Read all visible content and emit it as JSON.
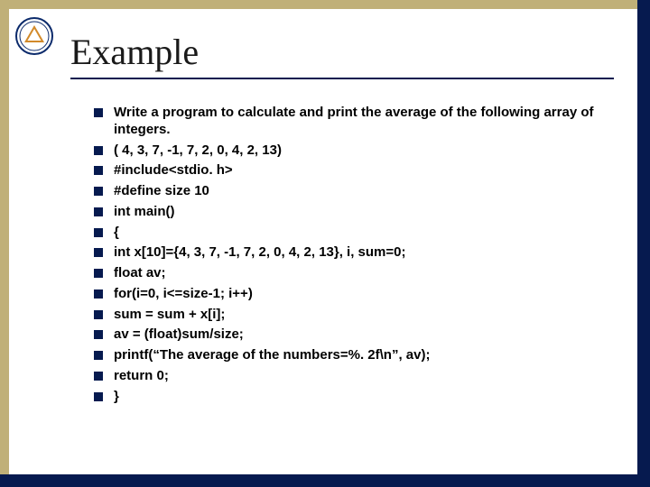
{
  "title": "Example",
  "bullets": [
    "Write a program to calculate and print the average of the following array of integers.",
    "( 4, 3, 7, -1, 7, 2, 0, 4, 2, 13)",
    "#include<stdio. h>",
    "#define size 10",
    "int main()",
    "{",
    "int x[10]={4, 3, 7, -1, 7, 2, 0, 4, 2, 13}, i, sum=0;",
    "float av;",
    "for(i=0, i<=size-1; i++)",
    "sum = sum + x[i];",
    "av = (float)sum/size;",
    "printf(“The average of the numbers=%. 2f\\n”, av);",
    "return 0;",
    "}"
  ],
  "colors": {
    "accent_tan": "#c0b078",
    "accent_navy": "#061a4f"
  }
}
